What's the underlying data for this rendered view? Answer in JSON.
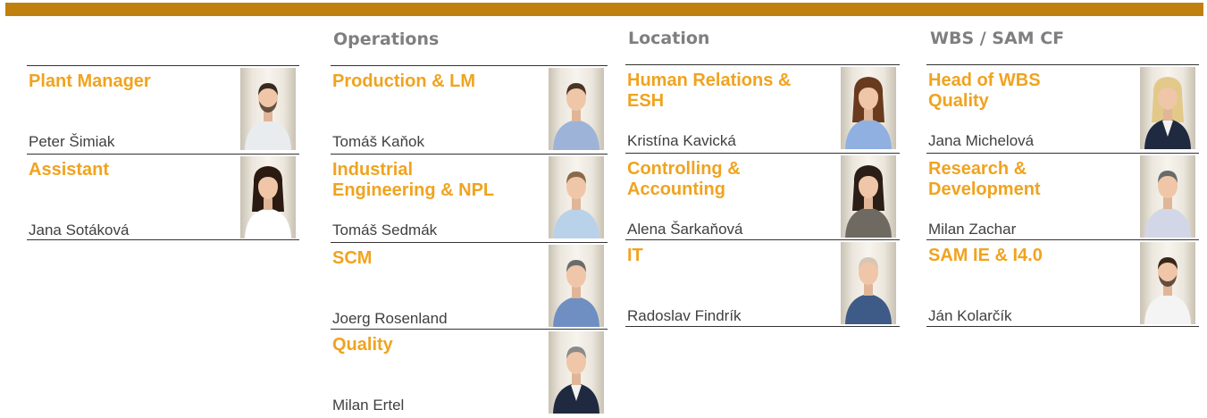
{
  "colors": {
    "accent_bar": "#c0800e",
    "role_text": "#f0a31f",
    "header_text": "#7f7f7f",
    "name_text": "#404040"
  },
  "columns": [
    {
      "header": "",
      "cards": [
        {
          "role": "Plant Manager",
          "name": "Peter Šimiak",
          "photo": {
            "shirt": "#e9ecef",
            "hair": "#3a2a1e",
            "beard": true
          }
        },
        {
          "role": "Assistant",
          "name": "Jana Sotáková",
          "photo": {
            "shirt": "#ffffff",
            "hair": "#2a1a12",
            "long_hair": true
          }
        }
      ]
    },
    {
      "header": "Operations",
      "cards": [
        {
          "role": "Production & LM",
          "name": "Tomáš Kaňok",
          "photo": {
            "shirt": "#9db4d8",
            "hair": "#4a3424"
          }
        },
        {
          "role": "Industrial\nEngineering & NPL",
          "name": "Tomáš Sedmák",
          "photo": {
            "shirt": "#b9d2ea",
            "hair": "#8a6a48"
          }
        },
        {
          "role": "SCM",
          "name": "Joerg Rosenland",
          "photo": {
            "shirt": "#6f8fc2",
            "hair": "#6b6b6b"
          }
        },
        {
          "role": "Quality",
          "name": "Milan Ertel",
          "photo": {
            "shirt": "#1f2a40",
            "hair": "#8a8a8a",
            "suit": true
          }
        }
      ]
    },
    {
      "header": "Location",
      "cards": [
        {
          "role": "Human Relations &\nESH",
          "name": "Kristína Kavická",
          "photo": {
            "shirt": "#8fb0e0",
            "hair": "#6a3a1e",
            "long_hair": true
          }
        },
        {
          "role": "Controlling &\nAccounting",
          "name": "Alena Šarkaňová",
          "photo": {
            "shirt": "#6e6a62",
            "hair": "#2a1e16",
            "long_hair": true
          }
        },
        {
          "role": " IT",
          "name": "Radoslav Findrík",
          "photo": {
            "shirt": "#3e5a86",
            "hair": "#d6c7b3"
          }
        }
      ]
    },
    {
      "header": "WBS / SAM CF",
      "cards": [
        {
          "role": "Head of WBS\nQuality",
          "name": "Jana Michelová",
          "photo": {
            "shirt": "#1f2a40",
            "hair": "#e2c98a",
            "long_hair": true,
            "suit": true
          }
        },
        {
          "role": "Research &\nDevelopment",
          "name": "Milan Zachar",
          "photo": {
            "shirt": "#d3d6e6",
            "hair": "#6a6a6a"
          }
        },
        {
          "role": "SAM IE & I4.0",
          "name": "Ján Kolarčík",
          "photo": {
            "shirt": "#f4f4f4",
            "hair": "#3a2618",
            "beard": true
          }
        }
      ]
    }
  ]
}
